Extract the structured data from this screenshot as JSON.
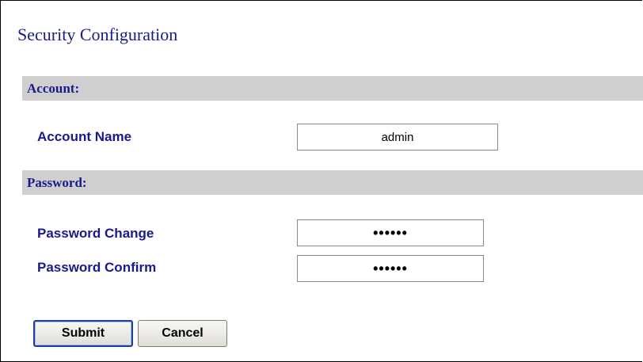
{
  "page": {
    "title": "Security Configuration"
  },
  "sections": {
    "account": {
      "header": "Account:",
      "account_name_label": "Account Name",
      "account_name_value": "admin"
    },
    "password": {
      "header": "Password:",
      "change_label": "Password Change",
      "change_value": "••••••",
      "confirm_label": "Password Confirm",
      "confirm_value": "••••••"
    }
  },
  "buttons": {
    "submit_label": "Submit",
    "cancel_label": "Cancel"
  },
  "colors": {
    "label_text": "#1a1a8c",
    "section_bar_bg": "#cfcfcf",
    "submit_border": "#1f3f9a"
  }
}
